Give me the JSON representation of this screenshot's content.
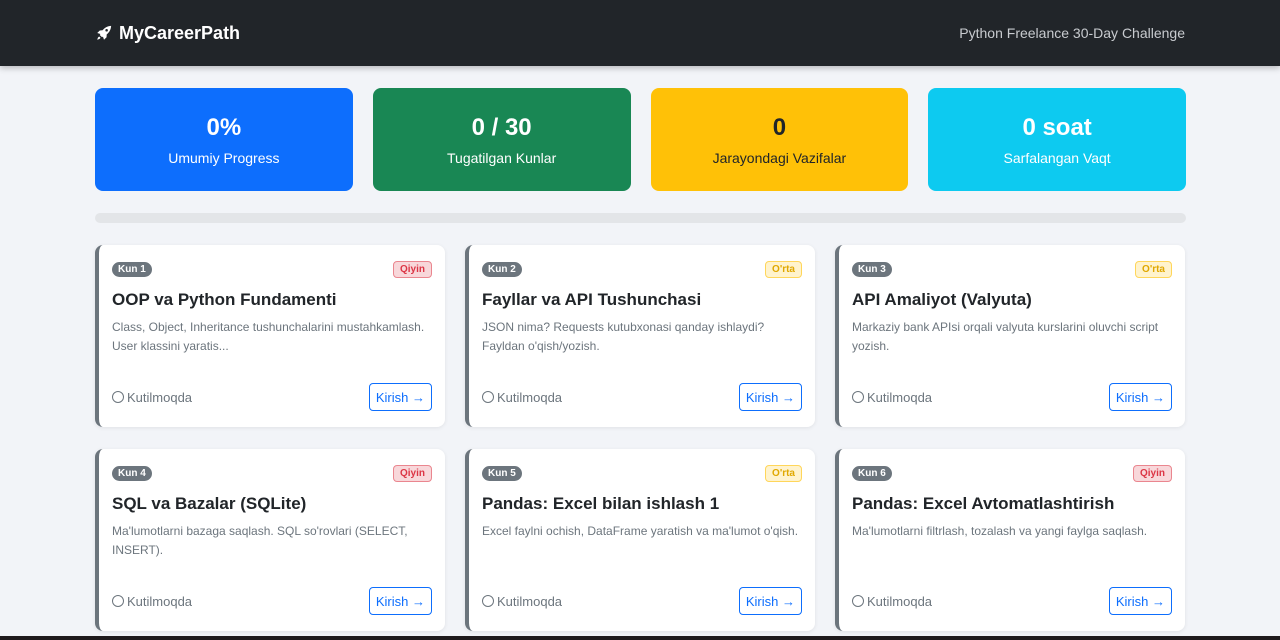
{
  "navbar": {
    "brand": "MyCareerPath",
    "brand_icon": "rocket-icon",
    "subtitle": "Python Freelance 30-Day Challenge"
  },
  "stats": [
    {
      "value": "0%",
      "label": "Umumiy Progress",
      "color": "#0d6efd"
    },
    {
      "value": "0 / 30",
      "label": "Tugatilgan Kunlar",
      "color": "#198754"
    },
    {
      "value": "0",
      "label": "Jarayondagi Vazifalar",
      "color": "#ffc107"
    },
    {
      "value": "0 soat",
      "label": "Sarfalangan Vaqt",
      "color": "#0dcaf0"
    }
  ],
  "progress": 0,
  "colors": {
    "hard": "#dc3545",
    "medium": "#ffc107",
    "primary": "#0d6efd"
  },
  "cards": [
    {
      "day": "Kun 1",
      "difficulty": "Qiyin",
      "title": "OOP va Python Fundamenti",
      "desc": "Class, Object, Inheritance tushunchalarini mustahkamlash. User klassini yaratis...",
      "status": "Kutilmoqda",
      "button": "Kirish →"
    },
    {
      "day": "Kun 2",
      "difficulty": "O'rta",
      "title": "Fayllar va API Tushunchasi",
      "desc": "JSON nima? Requests kutubxonasi qanday ishlaydi? Fayldan o'qish/yozish.",
      "status": "Kutilmoqda",
      "button": "Kirish →"
    },
    {
      "day": "Kun 3",
      "difficulty": "O'rta",
      "title": "API Amaliyot (Valyuta)",
      "desc": "Markaziy bank APIsi orqali valyuta kurslarini oluvchi script yozish.",
      "status": "Kutilmoqda",
      "button": "Kirish →"
    },
    {
      "day": "Kun 4",
      "difficulty": "Qiyin",
      "title": "SQL va Bazalar (SQLite)",
      "desc": "Ma'lumotlarni bazaga saqlash. SQL so'rovlari (SELECT, INSERT).",
      "status": "Kutilmoqda",
      "button": "Kirish →"
    },
    {
      "day": "Kun 5",
      "difficulty": "O'rta",
      "title": "Pandas: Excel bilan ishlash 1",
      "desc": "Excel faylni ochish, DataFrame yaratish va ma'lumot o'qish.",
      "status": "Kutilmoqda",
      "button": "Kirish →"
    },
    {
      "day": "Kun 6",
      "difficulty": "Qiyin",
      "title": "Pandas: Excel Avtomatlashtirish",
      "desc": "Ma'lumotlarni filtrlash, tozalash va yangi faylga saqlash.",
      "status": "Kutilmoqda",
      "button": "Kirish →"
    }
  ]
}
